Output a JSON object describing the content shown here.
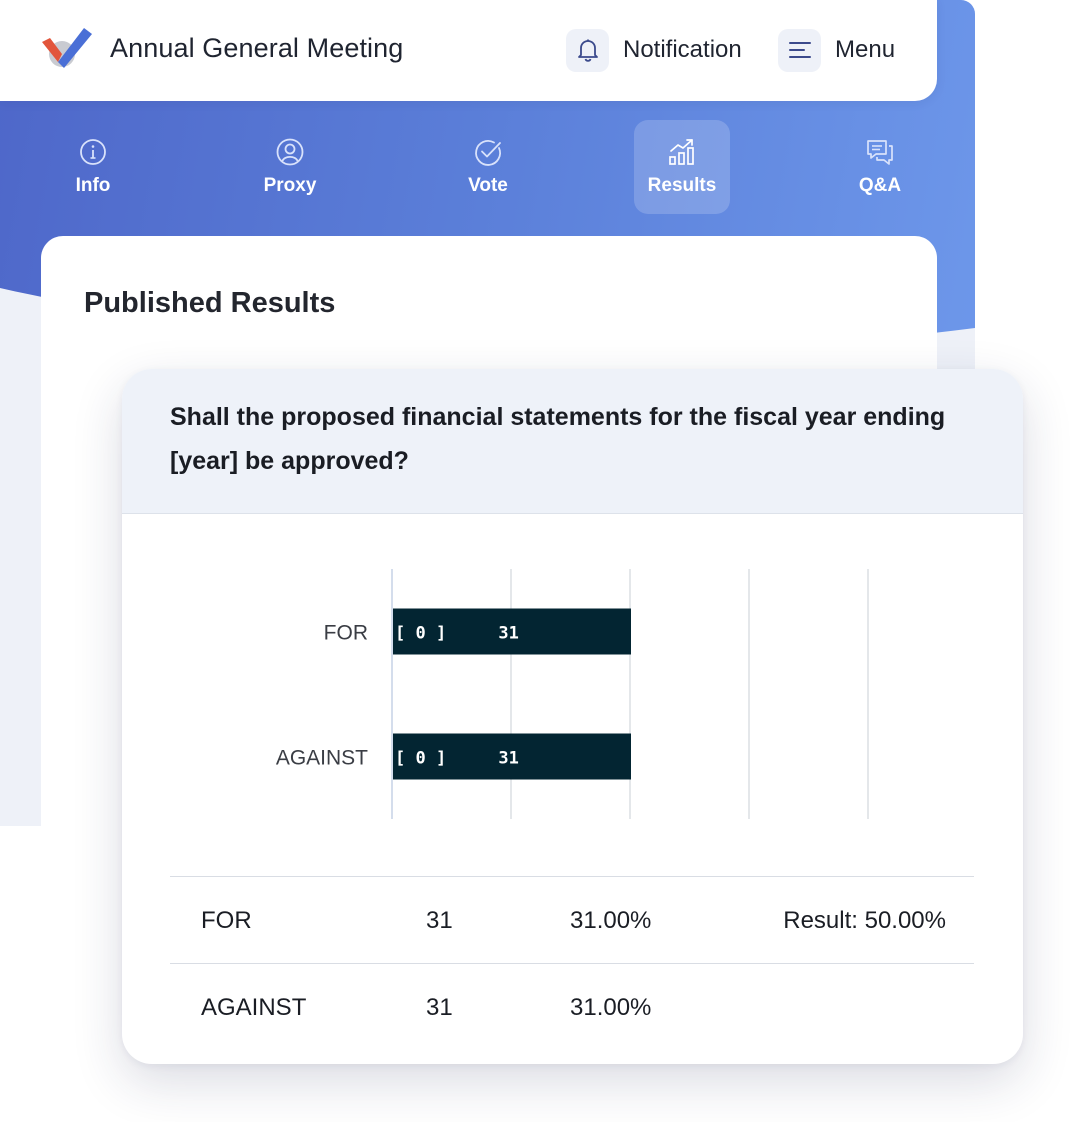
{
  "header": {
    "title": "Annual General Meeting",
    "notification_label": "Notification",
    "menu_label": "Menu"
  },
  "tabs": [
    {
      "label": "Info",
      "icon": "info-icon"
    },
    {
      "label": "Proxy",
      "icon": "user-circle-icon"
    },
    {
      "label": "Vote",
      "icon": "check-circle-icon"
    },
    {
      "label": "Results",
      "icon": "bar-chart-icon",
      "active": true
    },
    {
      "label": "Q&A",
      "icon": "chat-icon"
    }
  ],
  "section_title": "Published Results",
  "question": {
    "text": "Shall the proposed financial statements for the fiscal year ending [year] be approved?"
  },
  "chart_data": {
    "type": "bar",
    "orientation": "horizontal",
    "categories": [
      "FOR",
      "AGAINST"
    ],
    "values": [
      31,
      31
    ],
    "bar_prefix_labels": [
      "[ 0 ]",
      "[ 0 ]"
    ],
    "data_labels": [
      "31",
      "31"
    ],
    "xlim": [
      0,
      62
    ],
    "grid": true,
    "bar_color": "#032532"
  },
  "results_table": [
    {
      "option": "FOR",
      "votes": "31",
      "percent": "31.00%",
      "result": "Result: 50.00%"
    },
    {
      "option": "AGAINST",
      "votes": "31",
      "percent": "31.00%",
      "result": ""
    }
  ],
  "colors": {
    "accent": "#5b7fd9",
    "brand_check_blue": "#4a6fd6",
    "brand_check_red": "#e2553b"
  }
}
